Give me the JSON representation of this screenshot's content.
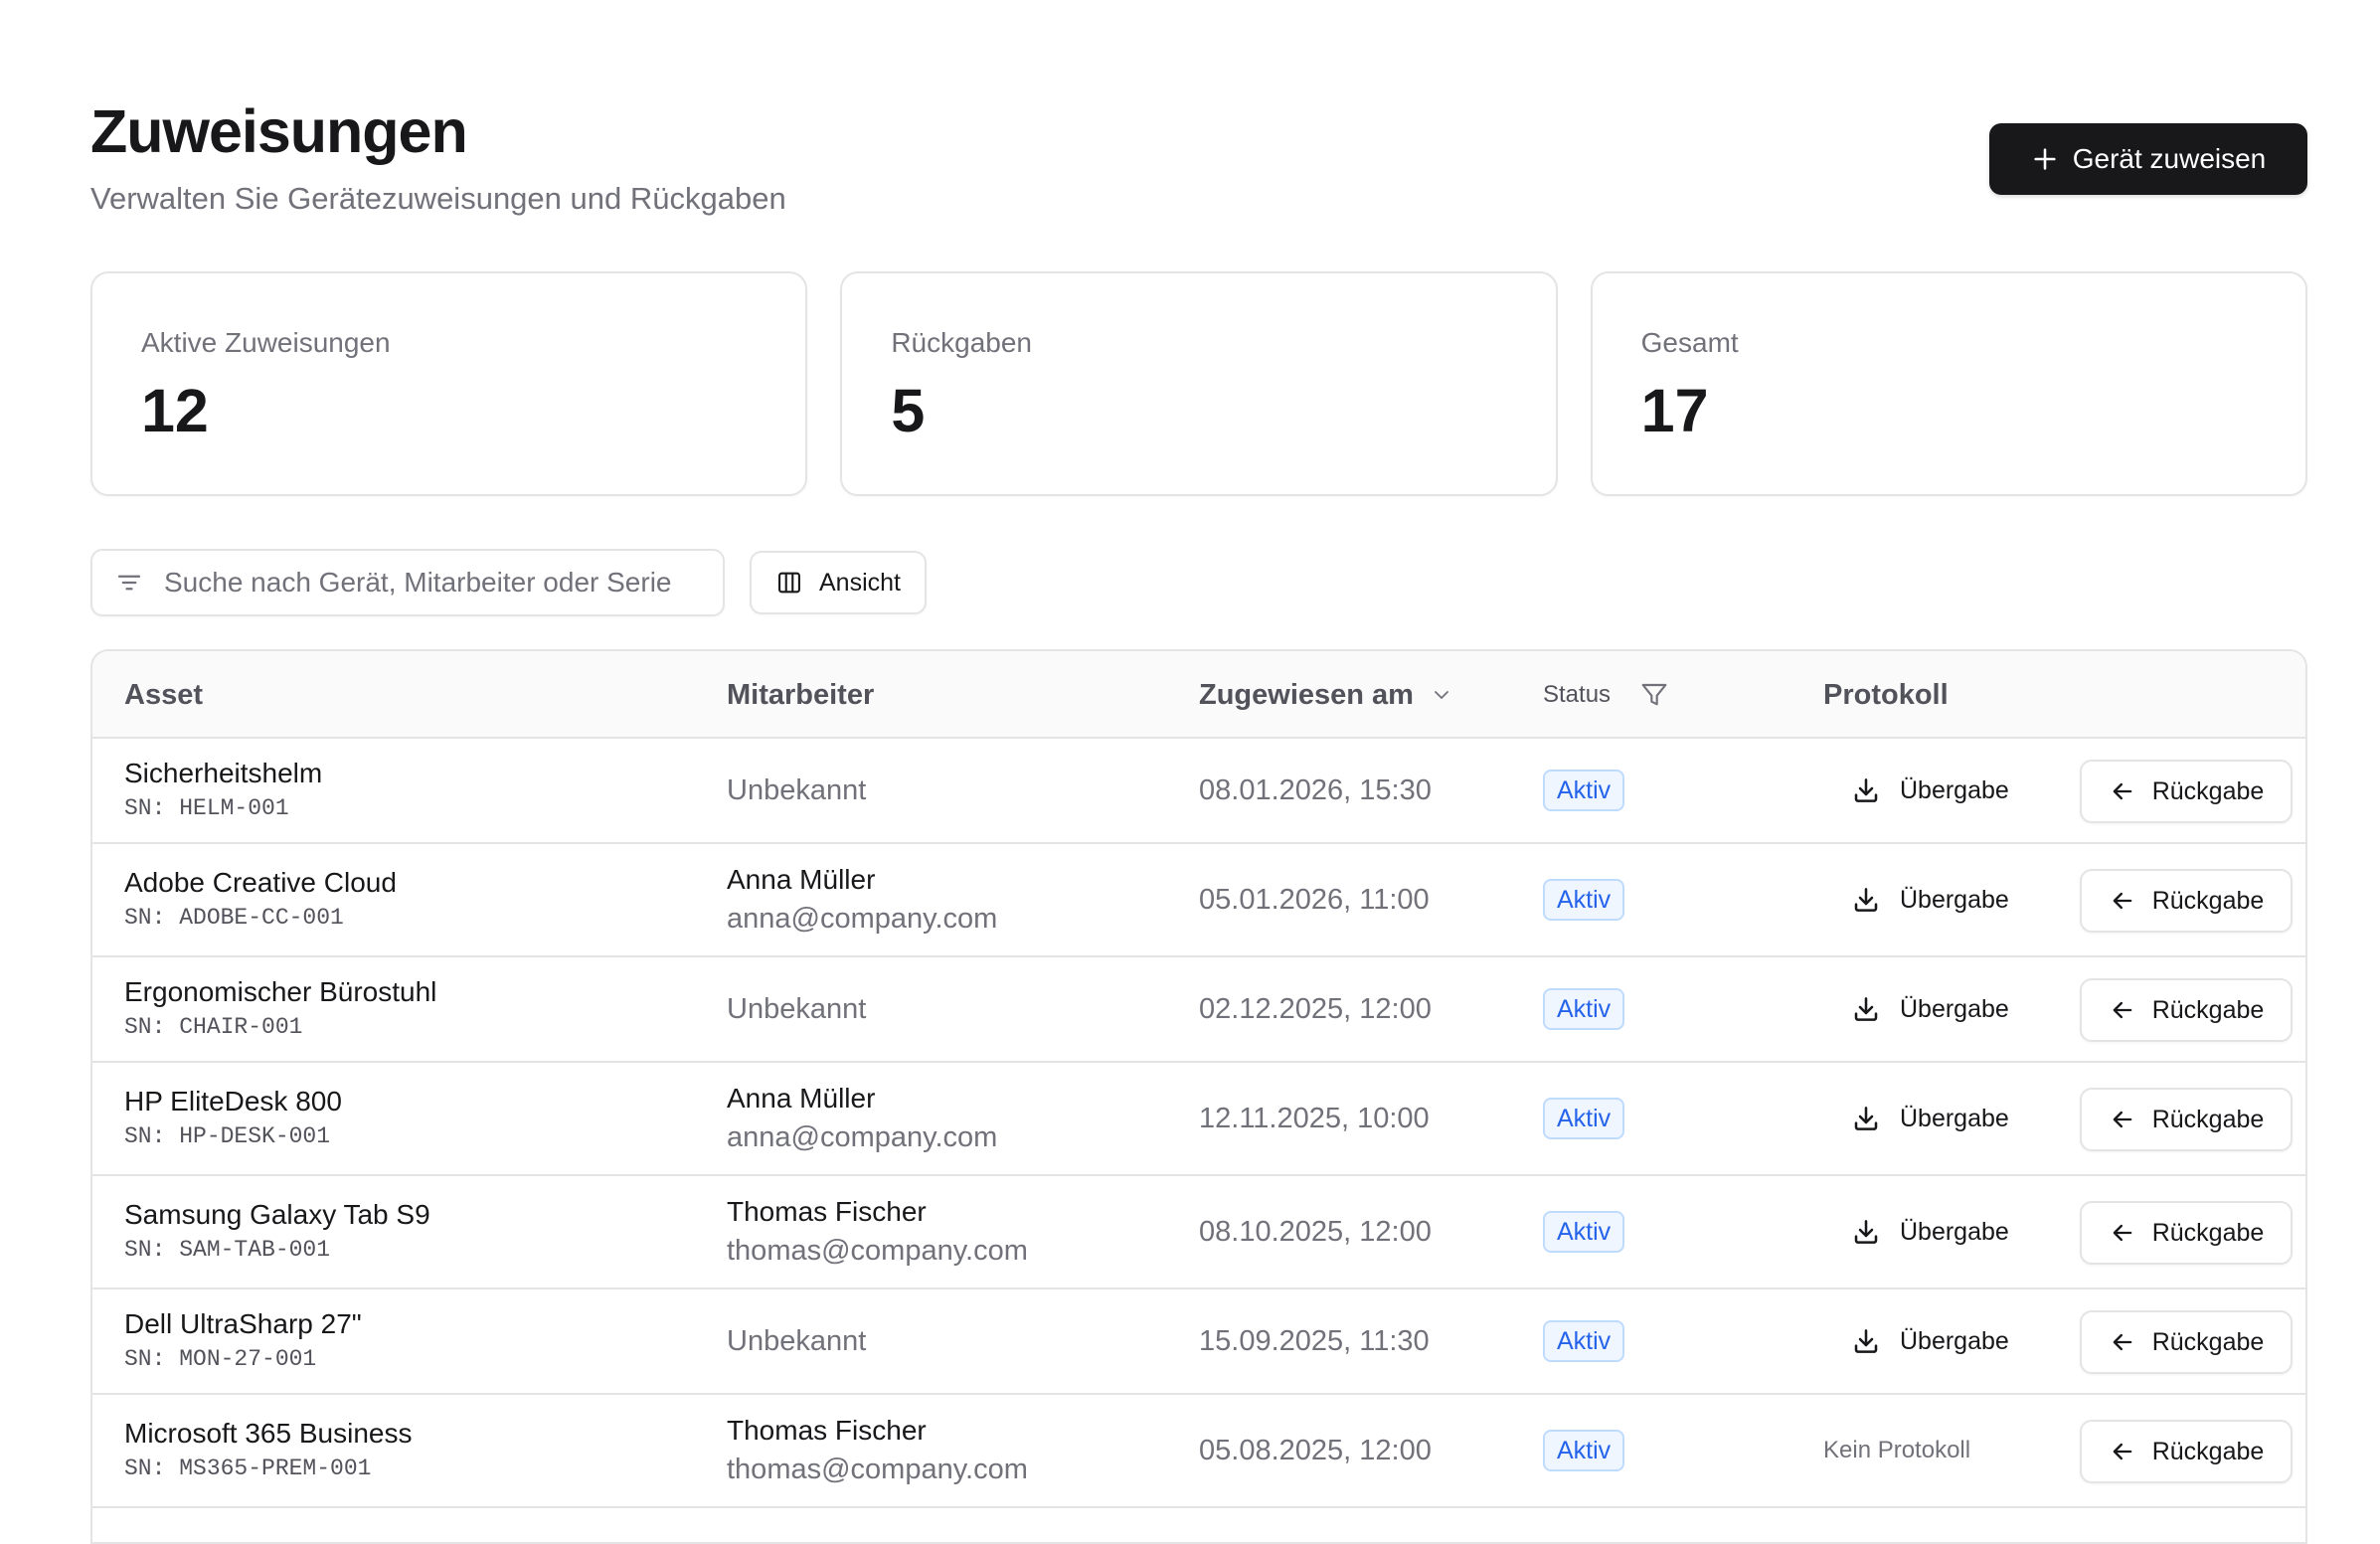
{
  "header": {
    "title": "Zuweisungen",
    "subtitle": "Verwalten Sie Gerätezuweisungen und Rückgaben",
    "primary_button": "Gerät zuweisen"
  },
  "stats": [
    {
      "label": "Aktive Zuweisungen",
      "value": "12"
    },
    {
      "label": "Rückgaben",
      "value": "5"
    },
    {
      "label": "Gesamt",
      "value": "17"
    }
  ],
  "toolbar": {
    "search_placeholder": "Suche nach Gerät, Mitarbeiter oder Serie",
    "view_label": "Ansicht"
  },
  "table": {
    "columns": {
      "asset": "Asset",
      "employee": "Mitarbeiter",
      "assigned": "Zugewiesen am",
      "status": "Status",
      "protocol": "Protokoll"
    },
    "protocol_label": "Übergabe",
    "no_protocol_label": "Kein Protokoll",
    "return_label": "Rückgabe",
    "rows": [
      {
        "asset": "Sicherheitshelm",
        "sn": "SN: HELM-001",
        "employee": "Unbekannt",
        "email": "",
        "date": "08.01.2026, 15:30",
        "status": "Aktiv",
        "protocol": "Übergabe"
      },
      {
        "asset": "Adobe Creative Cloud",
        "sn": "SN: ADOBE-CC-001",
        "employee": "Anna Müller",
        "email": "anna@company.com",
        "date": "05.01.2026, 11:00",
        "status": "Aktiv",
        "protocol": "Übergabe"
      },
      {
        "asset": "Ergonomischer Bürostuhl",
        "sn": "SN: CHAIR-001",
        "employee": "Unbekannt",
        "email": "",
        "date": "02.12.2025, 12:00",
        "status": "Aktiv",
        "protocol": "Übergabe"
      },
      {
        "asset": "HP EliteDesk 800",
        "sn": "SN: HP-DESK-001",
        "employee": "Anna Müller",
        "email": "anna@company.com",
        "date": "12.11.2025, 10:00",
        "status": "Aktiv",
        "protocol": "Übergabe"
      },
      {
        "asset": "Samsung Galaxy Tab S9",
        "sn": "SN: SAM-TAB-001",
        "employee": "Thomas Fischer",
        "email": "thomas@company.com",
        "date": "08.10.2025, 12:00",
        "status": "Aktiv",
        "protocol": "Übergabe"
      },
      {
        "asset": "Dell UltraSharp 27\"",
        "sn": "SN: MON-27-001",
        "employee": "Unbekannt",
        "email": "",
        "date": "15.09.2025, 11:30",
        "status": "Aktiv",
        "protocol": "Übergabe"
      },
      {
        "asset": "Microsoft 365 Business",
        "sn": "SN: MS365-PREM-001",
        "employee": "Thomas Fischer",
        "email": "thomas@company.com",
        "date": "05.08.2025, 12:00",
        "status": "Aktiv",
        "protocol": "Kein Protokoll"
      }
    ]
  },
  "colors": {
    "primary": "#18181b",
    "badge_text": "#2563eb",
    "badge_bg": "#eff6ff",
    "border": "#e4e4e7",
    "muted_text": "#71717a"
  },
  "icons": {
    "primary_button": "plus-icon",
    "search": "filter-lines-icon",
    "view": "columns-icon",
    "sort": "chevron-down-icon",
    "status_filter": "funnel-icon",
    "protocol": "download-icon",
    "return": "arrow-left-icon"
  }
}
